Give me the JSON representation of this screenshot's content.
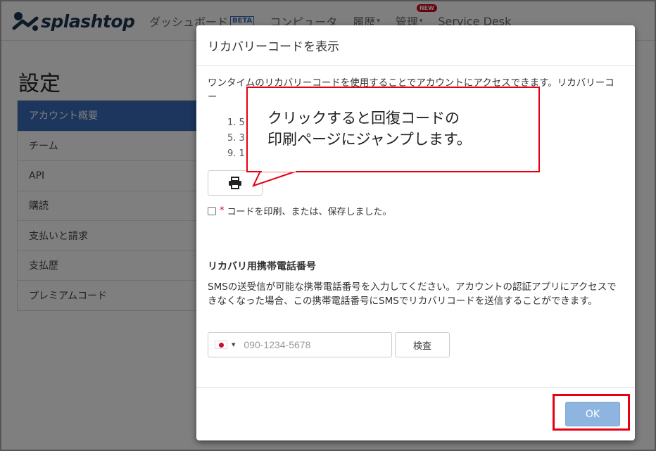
{
  "app": {
    "logo_text": "splashtop",
    "nav": [
      {
        "label": "ダッシュボード",
        "badge": "BETA"
      },
      {
        "label": "コンピュータ"
      },
      {
        "label": "履歴",
        "caret": "▾"
      },
      {
        "label": "管理",
        "caret": "▾",
        "badge": "NEW"
      },
      {
        "label": "Service Desk"
      }
    ]
  },
  "page": {
    "title": "設定",
    "sidebar": [
      {
        "label": "アカウント概要",
        "active": true
      },
      {
        "label": "チーム"
      },
      {
        "label": "API"
      },
      {
        "label": "購読"
      },
      {
        "label": "支払いと請求"
      },
      {
        "label": "支払歴"
      },
      {
        "label": "プレミアムコード"
      }
    ]
  },
  "modal": {
    "title": "リカバリーコードを表示",
    "intro": "ワンタイムのリカバリーコードを使用することでアカウントにアクセスできます。リカバリーコー",
    "code_prefixes": [
      "1. 5",
      "5. 3",
      "9. 1"
    ],
    "confirm_required": "*",
    "confirm_label": "コードを印刷、または、保存しました。",
    "sms_title": "リカバリ用携帯電話番号",
    "sms_desc": "SMSの送受信が可能な携帯電話番号を入力してください。アカウントの認証アプリにアクセスできなくなった場合、この携帯電話番号にSMSでリカバリコードを送信することができます。",
    "phone_placeholder": "090-1234-5678",
    "verify_label": "検査",
    "ok_label": "OK"
  },
  "callout": {
    "line1": "クリックすると回復コードの",
    "line2": "印刷ページにジャンプします。"
  },
  "colors": {
    "accent": "#3a6dbd",
    "highlight": "#e60012",
    "ok_button": "#8db5e0"
  }
}
